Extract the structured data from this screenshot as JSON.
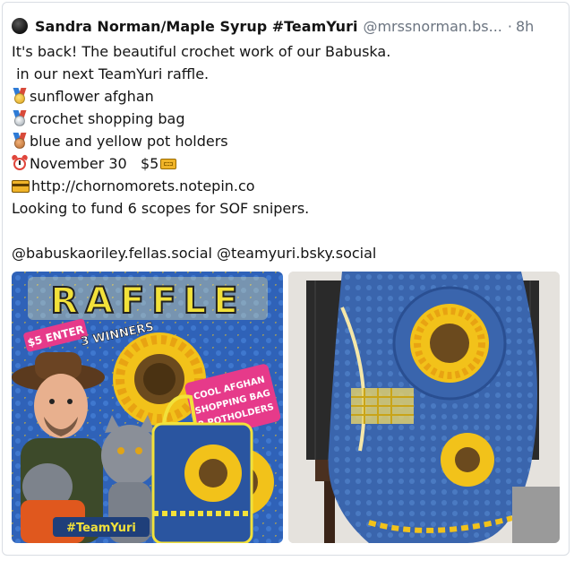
{
  "post": {
    "author_name": "Sandra Norman/Maple Syrup #TeamYuri",
    "author_handle": "@mrssnorman.bs...",
    "separator": "·",
    "timestamp": "8h",
    "lines": {
      "l1": "It's back! The beautiful crochet work of our Babuska.",
      "l2": " in our next TeamYuri raffle.",
      "l3": "sunflower afghan",
      "l4": "crochet shopping bag",
      "l5": "blue and yellow pot holders",
      "l6a": "November 30   $5",
      "l7": "http://chornomorets.notepin.co",
      "l8": "Looking to fund 6 scopes for SOF snipers.",
      "l10": "@babuskaoriley.fellas.social @teamyuri.bsky.social"
    },
    "icons": {
      "avatar": "avatar",
      "medal1": "gold-medal-icon",
      "medal2": "silver-medal-icon",
      "medal3": "bronze-medal-icon",
      "clock": "alarm-clock-icon",
      "ticket": "ticket-icon",
      "card": "credit-card-icon"
    }
  },
  "images": {
    "raffle_image": {
      "headline": "RAFFLE",
      "price": "$5 ENTER",
      "winners": "3 WINNERS",
      "items": [
        "COOL AFGHAN",
        "SHOPPING BAG",
        "2 POTHOLDERS"
      ],
      "hashtag": "#TeamYuri"
    },
    "afghan_photo": {}
  },
  "colors": {
    "text": "#141414",
    "muted": "#6b7480",
    "raffle_blue": "#2f62b8",
    "sunflower_yellow": "#f2c21a",
    "badge_pink": "#e63a8a"
  }
}
